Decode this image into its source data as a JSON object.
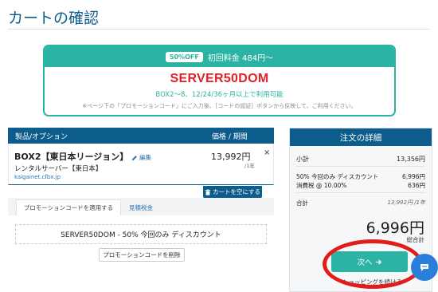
{
  "page": {
    "title": "カートの確認"
  },
  "promo": {
    "badge": "50%OFF",
    "first_price": "初回料金 484円〜",
    "code": "SERVER50DOM",
    "condition": "BOX2〜8、12/24/36ヶ月以上で利用可能",
    "note": "※ページ下の「プロモーションコード」にご入力後、［コードの認証］ボタンから反映して、ご利用ください。"
  },
  "cart": {
    "headers": {
      "product": "製品/オプション",
      "price": "価格 / 期間"
    },
    "item": {
      "name": "BOX2【東日本リージョン】",
      "edit_label": "編集",
      "subtitle": "レンタルサーバー【東日本】",
      "domain": "kaigainet.cfbx.jp",
      "price": "13,992円",
      "cycle": "/1年",
      "remove_symbol": "×"
    },
    "empty_button": "カートを空にする"
  },
  "tabs": [
    {
      "label": "プロモーションコードを適用する",
      "active": true
    },
    {
      "label": "見積税金",
      "active": false
    }
  ],
  "promo_applied": {
    "text": "SERVER50DOM - 50% 今回のみ ディスカウント",
    "remove_button": "プロモーションコードを削除"
  },
  "order_summary": {
    "title": "注文の詳細",
    "subtotal_label": "小計",
    "subtotal_value": "13,356円",
    "discount_label": "50% 今回のみ ディスカウント",
    "discount_value": "6,996円",
    "tax_label": "消費税 @ 10.00%",
    "tax_value": "636円",
    "total_label": "合計",
    "total_recurring": "13,992円 /1年",
    "total_amount": "6,996円",
    "total_amount_label": "総合計",
    "next_button": "次へ",
    "continue_link": "ショッピングを続ける"
  },
  "colors": {
    "primary": "#0d5d8c",
    "accent": "#2bb3a3",
    "promo_code": "#e3202a",
    "highlight": "#e41b1b",
    "chat": "#2a7fd8"
  },
  "icons": {
    "edit": "pencil-icon",
    "empty_cart": "trash-icon",
    "next": "arrow-right-icon",
    "chat": "chat-icon"
  }
}
